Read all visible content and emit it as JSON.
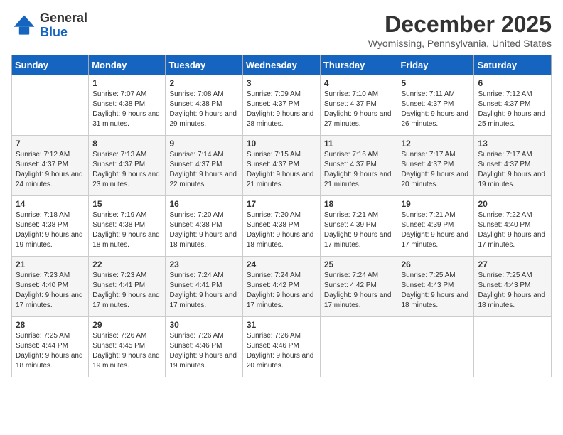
{
  "header": {
    "logo_line1": "General",
    "logo_line2": "Blue",
    "month": "December 2025",
    "location": "Wyomissing, Pennsylvania, United States"
  },
  "days_of_week": [
    "Sunday",
    "Monday",
    "Tuesday",
    "Wednesday",
    "Thursday",
    "Friday",
    "Saturday"
  ],
  "weeks": [
    [
      {
        "num": "",
        "sunrise": "",
        "sunset": "",
        "daylight": "",
        "empty": true
      },
      {
        "num": "1",
        "sunrise": "Sunrise: 7:07 AM",
        "sunset": "Sunset: 4:38 PM",
        "daylight": "Daylight: 9 hours and 31 minutes."
      },
      {
        "num": "2",
        "sunrise": "Sunrise: 7:08 AM",
        "sunset": "Sunset: 4:38 PM",
        "daylight": "Daylight: 9 hours and 29 minutes."
      },
      {
        "num": "3",
        "sunrise": "Sunrise: 7:09 AM",
        "sunset": "Sunset: 4:37 PM",
        "daylight": "Daylight: 9 hours and 28 minutes."
      },
      {
        "num": "4",
        "sunrise": "Sunrise: 7:10 AM",
        "sunset": "Sunset: 4:37 PM",
        "daylight": "Daylight: 9 hours and 27 minutes."
      },
      {
        "num": "5",
        "sunrise": "Sunrise: 7:11 AM",
        "sunset": "Sunset: 4:37 PM",
        "daylight": "Daylight: 9 hours and 26 minutes."
      },
      {
        "num": "6",
        "sunrise": "Sunrise: 7:12 AM",
        "sunset": "Sunset: 4:37 PM",
        "daylight": "Daylight: 9 hours and 25 minutes."
      }
    ],
    [
      {
        "num": "7",
        "sunrise": "Sunrise: 7:12 AM",
        "sunset": "Sunset: 4:37 PM",
        "daylight": "Daylight: 9 hours and 24 minutes."
      },
      {
        "num": "8",
        "sunrise": "Sunrise: 7:13 AM",
        "sunset": "Sunset: 4:37 PM",
        "daylight": "Daylight: 9 hours and 23 minutes."
      },
      {
        "num": "9",
        "sunrise": "Sunrise: 7:14 AM",
        "sunset": "Sunset: 4:37 PM",
        "daylight": "Daylight: 9 hours and 22 minutes."
      },
      {
        "num": "10",
        "sunrise": "Sunrise: 7:15 AM",
        "sunset": "Sunset: 4:37 PM",
        "daylight": "Daylight: 9 hours and 21 minutes."
      },
      {
        "num": "11",
        "sunrise": "Sunrise: 7:16 AM",
        "sunset": "Sunset: 4:37 PM",
        "daylight": "Daylight: 9 hours and 21 minutes."
      },
      {
        "num": "12",
        "sunrise": "Sunrise: 7:17 AM",
        "sunset": "Sunset: 4:37 PM",
        "daylight": "Daylight: 9 hours and 20 minutes."
      },
      {
        "num": "13",
        "sunrise": "Sunrise: 7:17 AM",
        "sunset": "Sunset: 4:37 PM",
        "daylight": "Daylight: 9 hours and 19 minutes."
      }
    ],
    [
      {
        "num": "14",
        "sunrise": "Sunrise: 7:18 AM",
        "sunset": "Sunset: 4:38 PM",
        "daylight": "Daylight: 9 hours and 19 minutes."
      },
      {
        "num": "15",
        "sunrise": "Sunrise: 7:19 AM",
        "sunset": "Sunset: 4:38 PM",
        "daylight": "Daylight: 9 hours and 18 minutes."
      },
      {
        "num": "16",
        "sunrise": "Sunrise: 7:20 AM",
        "sunset": "Sunset: 4:38 PM",
        "daylight": "Daylight: 9 hours and 18 minutes."
      },
      {
        "num": "17",
        "sunrise": "Sunrise: 7:20 AM",
        "sunset": "Sunset: 4:38 PM",
        "daylight": "Daylight: 9 hours and 18 minutes."
      },
      {
        "num": "18",
        "sunrise": "Sunrise: 7:21 AM",
        "sunset": "Sunset: 4:39 PM",
        "daylight": "Daylight: 9 hours and 17 minutes."
      },
      {
        "num": "19",
        "sunrise": "Sunrise: 7:21 AM",
        "sunset": "Sunset: 4:39 PM",
        "daylight": "Daylight: 9 hours and 17 minutes."
      },
      {
        "num": "20",
        "sunrise": "Sunrise: 7:22 AM",
        "sunset": "Sunset: 4:40 PM",
        "daylight": "Daylight: 9 hours and 17 minutes."
      }
    ],
    [
      {
        "num": "21",
        "sunrise": "Sunrise: 7:23 AM",
        "sunset": "Sunset: 4:40 PM",
        "daylight": "Daylight: 9 hours and 17 minutes."
      },
      {
        "num": "22",
        "sunrise": "Sunrise: 7:23 AM",
        "sunset": "Sunset: 4:41 PM",
        "daylight": "Daylight: 9 hours and 17 minutes."
      },
      {
        "num": "23",
        "sunrise": "Sunrise: 7:24 AM",
        "sunset": "Sunset: 4:41 PM",
        "daylight": "Daylight: 9 hours and 17 minutes."
      },
      {
        "num": "24",
        "sunrise": "Sunrise: 7:24 AM",
        "sunset": "Sunset: 4:42 PM",
        "daylight": "Daylight: 9 hours and 17 minutes."
      },
      {
        "num": "25",
        "sunrise": "Sunrise: 7:24 AM",
        "sunset": "Sunset: 4:42 PM",
        "daylight": "Daylight: 9 hours and 17 minutes."
      },
      {
        "num": "26",
        "sunrise": "Sunrise: 7:25 AM",
        "sunset": "Sunset: 4:43 PM",
        "daylight": "Daylight: 9 hours and 18 minutes."
      },
      {
        "num": "27",
        "sunrise": "Sunrise: 7:25 AM",
        "sunset": "Sunset: 4:43 PM",
        "daylight": "Daylight: 9 hours and 18 minutes."
      }
    ],
    [
      {
        "num": "28",
        "sunrise": "Sunrise: 7:25 AM",
        "sunset": "Sunset: 4:44 PM",
        "daylight": "Daylight: 9 hours and 18 minutes."
      },
      {
        "num": "29",
        "sunrise": "Sunrise: 7:26 AM",
        "sunset": "Sunset: 4:45 PM",
        "daylight": "Daylight: 9 hours and 19 minutes."
      },
      {
        "num": "30",
        "sunrise": "Sunrise: 7:26 AM",
        "sunset": "Sunset: 4:46 PM",
        "daylight": "Daylight: 9 hours and 19 minutes."
      },
      {
        "num": "31",
        "sunrise": "Sunrise: 7:26 AM",
        "sunset": "Sunset: 4:46 PM",
        "daylight": "Daylight: 9 hours and 20 minutes."
      },
      {
        "num": "",
        "sunrise": "",
        "sunset": "",
        "daylight": "",
        "empty": true
      },
      {
        "num": "",
        "sunrise": "",
        "sunset": "",
        "daylight": "",
        "empty": true
      },
      {
        "num": "",
        "sunrise": "",
        "sunset": "",
        "daylight": "",
        "empty": true
      }
    ]
  ]
}
